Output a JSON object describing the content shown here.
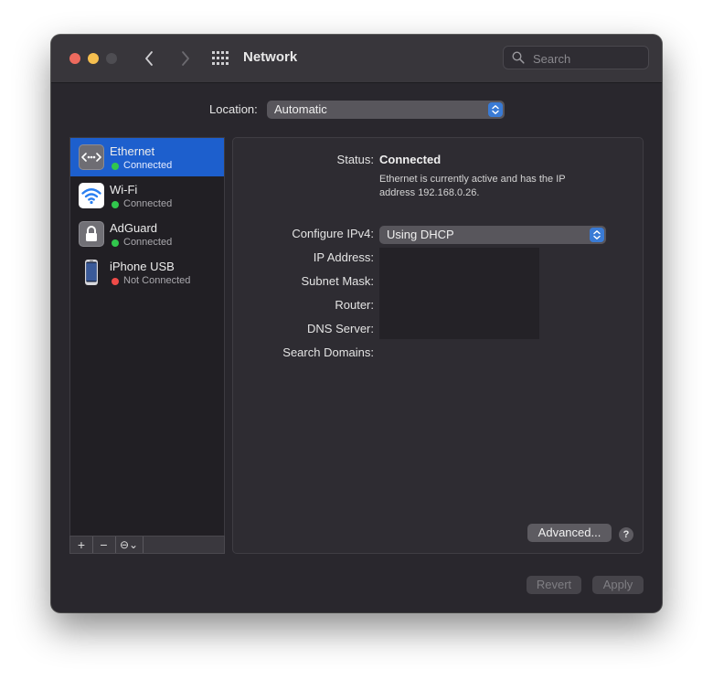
{
  "window": {
    "title": "Network"
  },
  "search": {
    "placeholder": "Search"
  },
  "location": {
    "label": "Location:",
    "value": "Automatic"
  },
  "services": [
    {
      "name": "Ethernet",
      "status": "Connected",
      "state": "connected",
      "icon": "ethernet-icon"
    },
    {
      "name": "Wi-Fi",
      "status": "Connected",
      "state": "connected",
      "icon": "wifi-icon"
    },
    {
      "name": "AdGuard",
      "status": "Connected",
      "state": "connected",
      "icon": "lock-icon"
    },
    {
      "name": "iPhone USB",
      "status": "Not Connected",
      "state": "disconnected",
      "icon": "iphone-icon"
    }
  ],
  "sidebar_toolbar": {
    "add": "+",
    "remove": "−",
    "action": "⊖⌄"
  },
  "detail": {
    "status_label": "Status:",
    "status_value": "Connected",
    "status_description": "Ethernet is currently active and has the IP address 192.168.0.26.",
    "configure_label": "Configure IPv4:",
    "configure_value": "Using DHCP",
    "ip_label": "IP Address:",
    "subnet_label": "Subnet Mask:",
    "router_label": "Router:",
    "dns_label": "DNS Server:",
    "search_domains_label": "Search Domains:"
  },
  "buttons": {
    "advanced": "Advanced...",
    "help": "?",
    "revert": "Revert",
    "apply": "Apply"
  },
  "colors": {
    "selection": "#1d5fcd",
    "connected": "#31c74d",
    "disconnected": "#ef4b48"
  }
}
